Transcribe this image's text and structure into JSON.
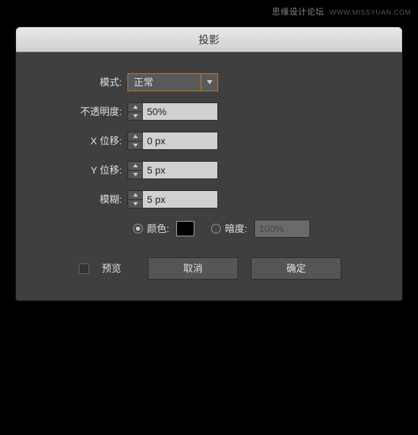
{
  "watermark": {
    "text1": "思缘设计论坛",
    "text2": "WWW.MISSYUAN.COM"
  },
  "dialog": {
    "title": "投影",
    "mode": {
      "label": "模式:",
      "value": "正常"
    },
    "opacity": {
      "label": "不透明度:",
      "value": "50%"
    },
    "xOffset": {
      "label": "X 位移:",
      "value": "0 px"
    },
    "yOffset": {
      "label": "Y 位移:",
      "value": "5 px"
    },
    "blur": {
      "label": "模糊:",
      "value": "5 px"
    },
    "colorOption": {
      "colorLabel": "颜色:",
      "colorValue": "#000000",
      "darknessLabel": "暗度:",
      "darknessValue": "100%"
    },
    "preview": {
      "label": "预览"
    },
    "buttons": {
      "cancel": "取消",
      "ok": "确定"
    }
  }
}
